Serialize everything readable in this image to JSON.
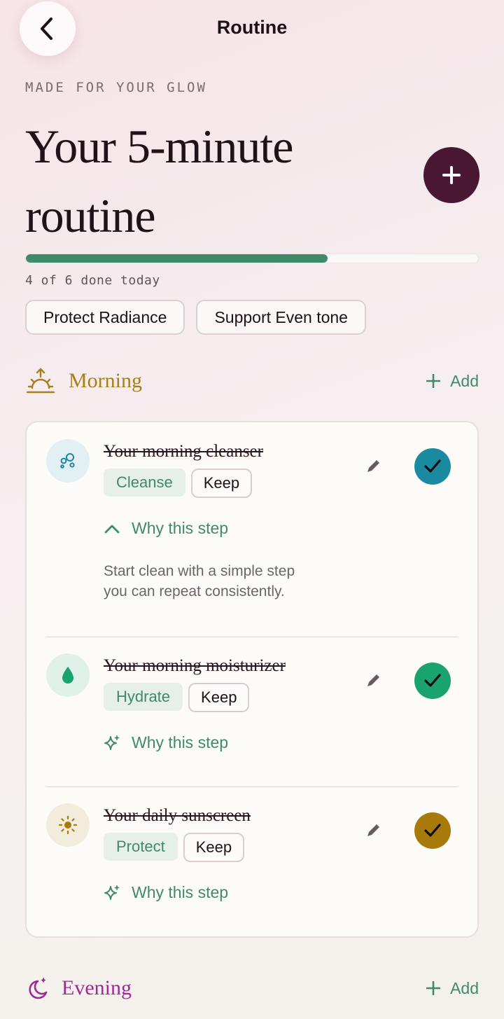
{
  "nav": {
    "title": "Routine",
    "back_icon": "chevron-left-icon"
  },
  "hero": {
    "kicker": "MADE FOR YOUR GLOW",
    "title_line1": "Your 5-minute",
    "title_line2": "routine",
    "add_icon": "plus-icon"
  },
  "progress": {
    "done": 4,
    "total": 6,
    "fraction": 0.667,
    "label": "4 of 6 done today",
    "color": "#3f8a6a"
  },
  "goals": [
    "Protect Radiance",
    "Support Even tone"
  ],
  "morning": {
    "title": "Morning",
    "icon": "sunrise-icon",
    "color": "#a8801a",
    "add_label": "Add",
    "steps": [
      {
        "title": "Your morning cleanser",
        "category": "Cleanse",
        "keep_label": "Keep",
        "icon": "bubbles-icon",
        "check_color": "#1a8aa0",
        "why_label": "Why this step",
        "why_expanded": true,
        "why_text": "Start clean with a simple step you can repeat consistently."
      },
      {
        "title": "Your morning moisturizer",
        "category": "Hydrate",
        "keep_label": "Keep",
        "icon": "droplet-icon",
        "check_color": "#1aa36f",
        "why_label": "Why this step",
        "why_expanded": false
      },
      {
        "title": "Your daily sunscreen",
        "category": "Protect",
        "keep_label": "Keep",
        "icon": "sun-icon",
        "check_color": "#a87a0a",
        "why_label": "Why this step",
        "why_expanded": false
      }
    ]
  },
  "evening": {
    "title": "Evening",
    "icon": "moon-stars-icon",
    "color": "#a2289a",
    "add_label": "Add"
  }
}
